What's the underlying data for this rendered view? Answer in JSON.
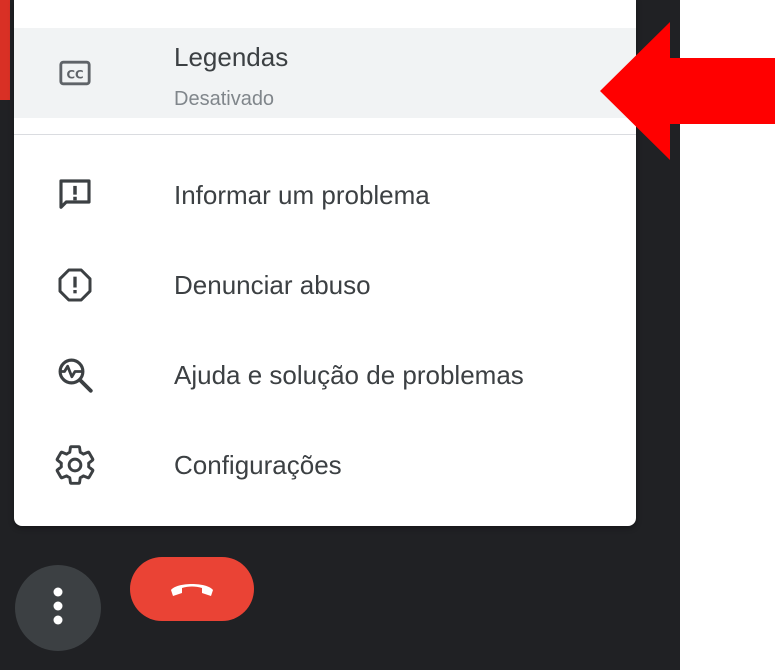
{
  "menu": {
    "items": [
      {
        "label": "Legendas",
        "sublabel": "Desativado",
        "icon": "closed-caption-icon"
      },
      {
        "label": "Informar um problema",
        "icon": "feedback-icon"
      },
      {
        "label": "Denunciar abuso",
        "icon": "report-icon"
      },
      {
        "label": "Ajuda e solução de problemas",
        "icon": "troubleshoot-icon"
      },
      {
        "label": "Configurações",
        "icon": "settings-icon"
      }
    ]
  },
  "controls": {
    "more_icon": "more-vertical-icon",
    "hangup_icon": "phone-hangup-icon"
  },
  "annotation": {
    "arrow_color": "#ff0000"
  },
  "colors": {
    "background_dark": "#202124",
    "accent_red": "#d93025",
    "hangup_red": "#ea4335",
    "menu_bg": "#ffffff",
    "highlight_bg": "#f1f3f4"
  }
}
